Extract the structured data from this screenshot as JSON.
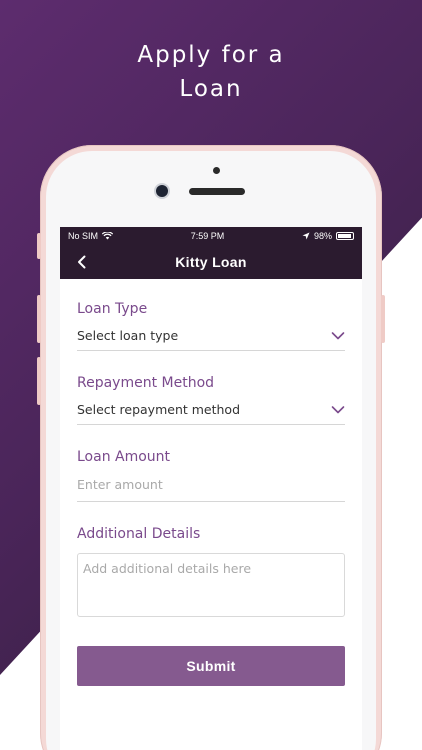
{
  "headline": {
    "line1": "Apply for a",
    "line2": "Loan"
  },
  "status": {
    "carrier": "No SIM",
    "wifi_icon": "wifi-icon",
    "time": "7:59 PM",
    "location_icon": "location-arrow-icon",
    "battery": "98%"
  },
  "nav": {
    "title": "Kitty Loan",
    "back_icon": "chevron-left-icon"
  },
  "form": {
    "loan_type": {
      "label": "Loan Type",
      "value": "Select loan type"
    },
    "repayment": {
      "label": "Repayment Method",
      "value": "Select repayment method"
    },
    "amount": {
      "label": "Loan Amount",
      "placeholder": "Enter amount",
      "value": ""
    },
    "details": {
      "label": "Additional Details",
      "placeholder": "Add additional details here",
      "value": ""
    },
    "submit_label": "Submit"
  },
  "colors": {
    "accent": "#7a4a8c",
    "button": "#855a8f",
    "nav_bg": "#2b1b2f",
    "bg_purple": "#4a2559"
  }
}
